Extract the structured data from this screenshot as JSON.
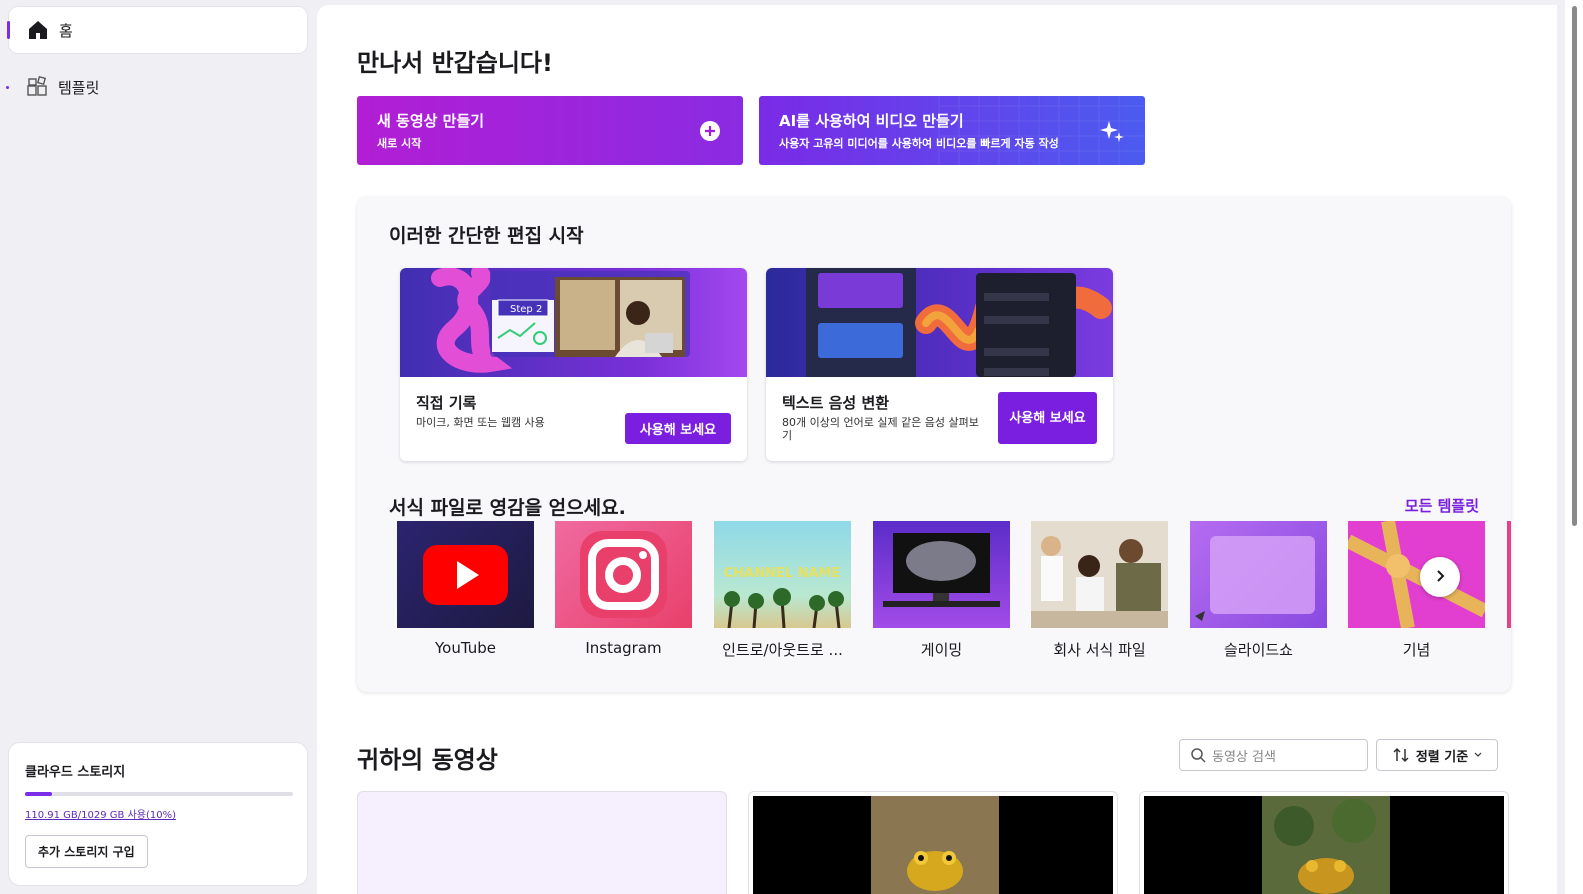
{
  "sidebar": {
    "items": [
      {
        "label": "홈",
        "icon": "home-icon"
      },
      {
        "label": "템플릿",
        "icon": "templates-icon"
      }
    ],
    "storage": {
      "title": "클라우드 스토리지",
      "usage_text": "110.91 GB/1029 GB 사용(10%)",
      "usage_fraction": 0.1,
      "buy_button": "추가 스토리지 구입"
    }
  },
  "main": {
    "greeting": "만나서 반갑습니다!",
    "hero": {
      "new_video": {
        "title": "새 동영상 만들기",
        "subtitle": "새로 시작"
      },
      "ai_video": {
        "title": "AI를 사용하여 비디오 만들기",
        "subtitle": "사용자 고유의 미디어를 사용하여 비디오를 빠르게 자동 작성"
      }
    },
    "quick_edit": {
      "title": "이러한 간단한 편집 시작",
      "cards": [
        {
          "title": "직접 기록",
          "description": "마이크, 화면 또는 웹캠 사용",
          "button": "사용해 보세요",
          "step_badge": "Step 2"
        },
        {
          "title": "텍스트 음성 변환",
          "description": "80개 이상의 언어로 실제 같은 음성 살펴보기",
          "button": "사용해 보세요"
        }
      ]
    },
    "templates": {
      "title": "서식 파일로 영감을 얻으세요.",
      "all_link": "모든 템플릿",
      "items": [
        {
          "label": "YouTube"
        },
        {
          "label": "Instagram"
        },
        {
          "label": "인트로/아웃트로 ...",
          "overlay": "CHANNEL NAME"
        },
        {
          "label": "게이밍"
        },
        {
          "label": "회사 서식 파일"
        },
        {
          "label": "슬라이드쇼"
        },
        {
          "label": "기념"
        }
      ]
    },
    "videos": {
      "title": "귀하의 동영상",
      "search_placeholder": "동영상 검색",
      "sort_label": "정렬 기준"
    }
  },
  "colors": {
    "accent": "#7a1fe0",
    "hero_magenta": "#b21ed4",
    "hero_blue": "#4b5bf0"
  }
}
